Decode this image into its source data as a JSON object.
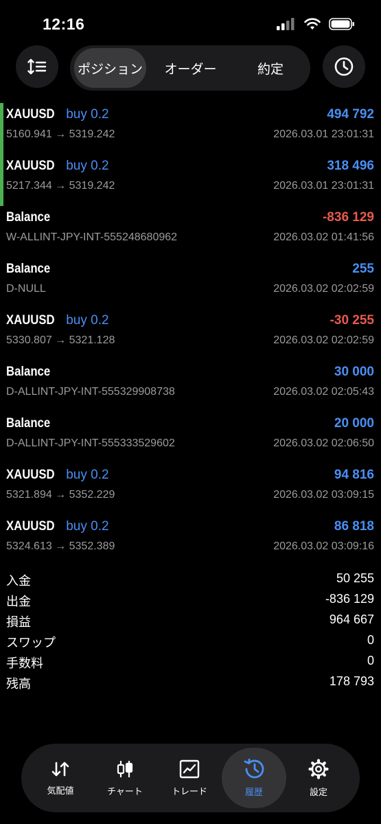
{
  "status": {
    "time": "12:16"
  },
  "tabs": [
    {
      "label": "ポジション",
      "active": true
    },
    {
      "label": "オーダー",
      "active": false
    },
    {
      "label": "約定",
      "active": false
    }
  ],
  "rows": [
    {
      "title": "XAUUSD",
      "side": "buy 0.2",
      "detail": "5160.941 → 5319.242",
      "value": "494 792",
      "time": "2026.03.01 23:01:31",
      "accent": true,
      "negative": false
    },
    {
      "title": "XAUUSD",
      "side": "buy 0.2",
      "detail": "5217.344 → 5319.242",
      "value": "318 496",
      "time": "2026.03.01 23:01:31",
      "accent": true,
      "negative": false
    },
    {
      "title": "Balance",
      "side": "",
      "detail": "W-ALLINT-JPY-INT-555248680962",
      "value": "-836 129",
      "time": "2026.03.02 01:41:56",
      "accent": false,
      "negative": true
    },
    {
      "title": "Balance",
      "side": "",
      "detail": "D-NULL",
      "value": "255",
      "time": "2026.03.02 02:02:59",
      "accent": false,
      "negative": false
    },
    {
      "title": "XAUUSD",
      "side": "buy 0.2",
      "detail": "5330.807 → 5321.128",
      "value": "-30 255",
      "time": "2026.03.02 02:02:59",
      "accent": false,
      "negative": true
    },
    {
      "title": "Balance",
      "side": "",
      "detail": "D-ALLINT-JPY-INT-555329908738",
      "value": "30 000",
      "time": "2026.03.02 02:05:43",
      "accent": false,
      "negative": false
    },
    {
      "title": "Balance",
      "side": "",
      "detail": "D-ALLINT-JPY-INT-555333529602",
      "value": "20 000",
      "time": "2026.03.02 02:06:50",
      "accent": false,
      "negative": false
    },
    {
      "title": "XAUUSD",
      "side": "buy 0.2",
      "detail": "5321.894 → 5352.229",
      "value": "94 816",
      "time": "2026.03.02 03:09:15",
      "accent": false,
      "negative": false
    },
    {
      "title": "XAUUSD",
      "side": "buy 0.2",
      "detail": "5324.613 → 5352.389",
      "value": "86 818",
      "time": "2026.03.02 03:09:16",
      "accent": false,
      "negative": false
    }
  ],
  "summary": [
    {
      "label": "入金",
      "value": "50 255"
    },
    {
      "label": "出金",
      "value": "-836 129"
    },
    {
      "label": "損益",
      "value": "964 667"
    },
    {
      "label": "スワップ",
      "value": "0"
    },
    {
      "label": "手数料",
      "value": "0"
    },
    {
      "label": "残高",
      "value": "178 793"
    }
  ],
  "nav": [
    {
      "label": "気配値",
      "icon": "quotes-arrows-icon",
      "active": false
    },
    {
      "label": "チャート",
      "icon": "candlestick-icon",
      "active": false
    },
    {
      "label": "トレード",
      "icon": "trade-line-chart-icon",
      "active": false
    },
    {
      "label": "履歴",
      "icon": "history-clock-icon",
      "active": true
    },
    {
      "label": "設定",
      "icon": "settings-gear-icon",
      "active": false
    }
  ],
  "colors": {
    "accent_blue": "#4a8ff5",
    "negative_red": "#e85a4f",
    "position_green": "#4caf50"
  }
}
